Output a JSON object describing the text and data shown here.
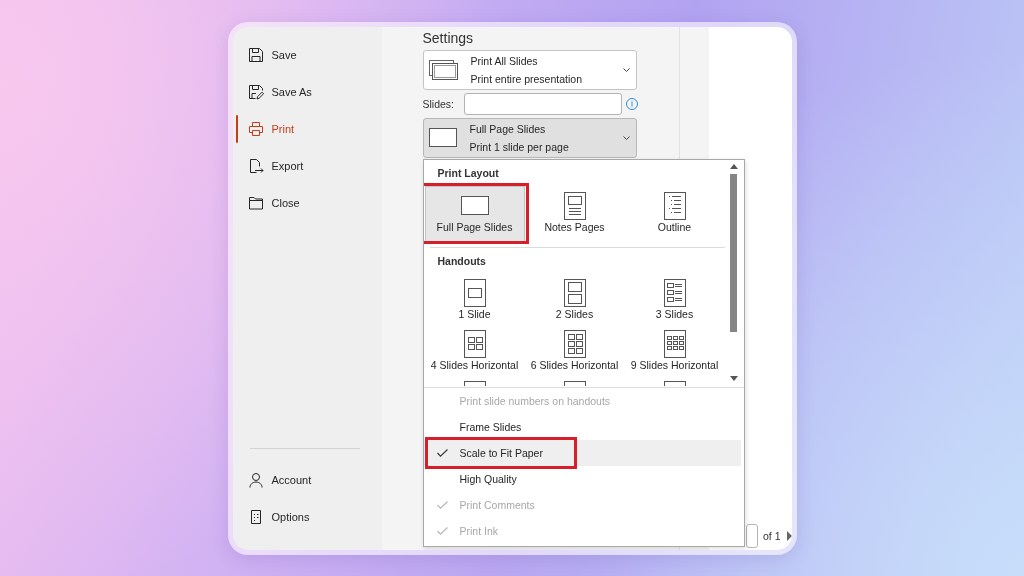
{
  "sidebar": {
    "items": [
      {
        "label": "Save",
        "selected": false
      },
      {
        "label": "Save As",
        "selected": false
      },
      {
        "label": "Print",
        "selected": true
      },
      {
        "label": "Export",
        "selected": false
      },
      {
        "label": "Close",
        "selected": false
      }
    ],
    "footer_items": [
      {
        "label": "Account",
        "selected": false
      },
      {
        "label": "Options",
        "selected": false
      }
    ]
  },
  "settings": {
    "heading": "Settings",
    "range_dropdown": {
      "title": "Print All Slides",
      "subtitle": "Print entire presentation"
    },
    "slides_field": {
      "label": "Slides:"
    },
    "layout_dropdown": {
      "title": "Full Page Slides",
      "subtitle": "Print 1 slide per page",
      "expanded": true
    }
  },
  "layout_menu": {
    "print_layout": {
      "heading": "Print Layout",
      "items": [
        {
          "label": "Full Page Slides",
          "selected": true,
          "annotated": true
        },
        {
          "label": "Notes Pages",
          "selected": false,
          "annotated": false
        },
        {
          "label": "Outline",
          "selected": false,
          "annotated": false
        }
      ]
    },
    "handouts": {
      "heading": "Handouts",
      "items": [
        {
          "label": "1 Slide",
          "selected": false
        },
        {
          "label": "2 Slides",
          "selected": false
        },
        {
          "label": "3 Slides",
          "selected": false
        },
        {
          "label": "4 Slides Horizontal",
          "selected": false
        },
        {
          "label": "6 Slides Horizontal",
          "selected": false
        },
        {
          "label": "9 Slides Horizontal",
          "selected": false
        },
        {
          "selected": false
        },
        {
          "selected": false
        },
        {
          "selected": false
        }
      ]
    },
    "options": [
      {
        "label": "Print slide numbers on handouts",
        "checked": false,
        "disabled": true,
        "highlighted": false,
        "annotated": false
      },
      {
        "label": "Frame Slides",
        "checked": false,
        "disabled": false,
        "highlighted": false,
        "annotated": false
      },
      {
        "label": "Scale to Fit Paper",
        "checked": true,
        "disabled": false,
        "highlighted": true,
        "annotated": true
      },
      {
        "label": "High Quality",
        "checked": false,
        "disabled": false,
        "highlighted": false,
        "annotated": false
      },
      {
        "label": "Print Comments",
        "checked": true,
        "disabled": true,
        "highlighted": false,
        "annotated": false
      },
      {
        "label": "Print Ink",
        "checked": true,
        "disabled": true,
        "highlighted": false,
        "annotated": false
      }
    ]
  },
  "preview": {
    "page_count": "of 1"
  }
}
